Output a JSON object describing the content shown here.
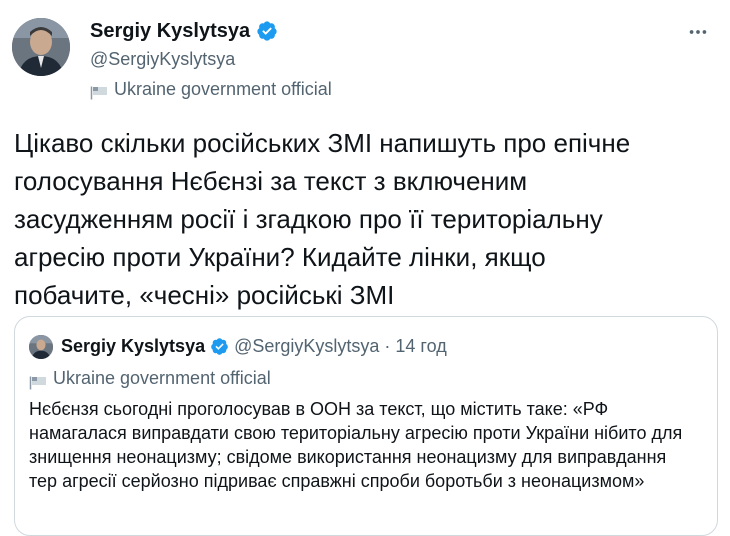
{
  "tweet": {
    "author_name": "Sergiy Kyslytsya",
    "author_handle": "@SergiyKyslytsya",
    "label": "Ukraine government official",
    "text": "Цікаво скільки російських ЗМІ напишуть про епічне\nголосування Нєбєнзі за текст з включеним\nзасудженням росії і згадкою про її територіальну\nагресію проти України? Кидайте лінки, якщо\nпобачите, «чесні» російські ЗМІ",
    "more_icon": "more-horizontal-icon",
    "verified_icon": "verified-badge-icon",
    "label_icon": "government-flag-icon"
  },
  "quoted": {
    "author_name": "Sergiy Kyslytsya",
    "author_handle": "@SergiyKyslytsya",
    "separator": "·",
    "time": "14 год",
    "label": "Ukraine government official",
    "text": "Нєбєнзя сьогодні проголосував в ООН за текст, що містить таке: «РФ\nнамагалася виправдати свою територіальну агресію проти України нібито для\nзнищення неонацизму; свідоме використання неонацизму для виправдання\nтер агресії серйозно підриває справжні спроби боротьби з неонацизмом»"
  },
  "colors": {
    "text_primary": "#0f1419",
    "text_secondary": "#536471",
    "verified_blue": "#1d9bf0",
    "border": "#cfd9de"
  }
}
